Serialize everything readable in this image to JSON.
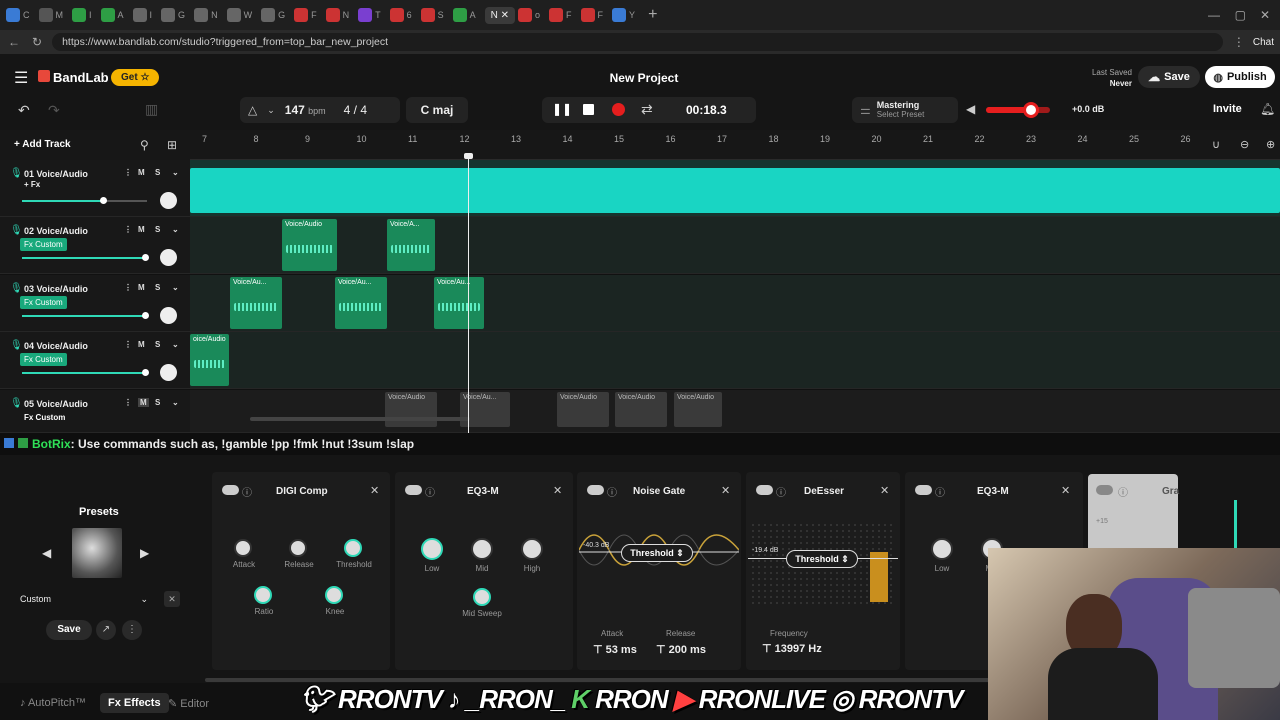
{
  "browser": {
    "url": "https://www.bandlab.com/studio?triggered_from=top_bar_new_project",
    "active_tab_label": "N",
    "chat_label": "Chat"
  },
  "app": {
    "logo": "BandLab",
    "get_label": "Get",
    "project_title": "New Project",
    "last_saved_label": "Last Saved",
    "last_saved_value": "Never",
    "save_label": "Save",
    "publish_label": "Publish",
    "invite_label": "Invite"
  },
  "toolbar": {
    "bpm": "147",
    "bpm_unit": "bpm",
    "time_sig": "4 / 4",
    "key": "C maj",
    "time": "00:18.3",
    "mastering_label": "Mastering",
    "mastering_preset": "Select Preset",
    "volume_db": "+0.0 dB",
    "volume_level": 0.7,
    "add_track_label": "Add Track"
  },
  "ruler": [
    "7",
    "8",
    "9",
    "10",
    "11",
    "12",
    "13",
    "14",
    "15",
    "16",
    "17",
    "18",
    "19",
    "20",
    "21",
    "22",
    "23",
    "24",
    "25",
    "26"
  ],
  "tracks": [
    {
      "name": "01 Voice/Audio",
      "fx": "+ Fx",
      "vol": 0.65
    },
    {
      "name": "02 Voice/Audio",
      "fx": "Fx Custom",
      "vol": 0.98
    },
    {
      "name": "03 Voice/Audio",
      "fx": "Fx Custom",
      "vol": 0.98
    },
    {
      "name": "04 Voice/Audio",
      "fx": "Fx Custom",
      "vol": 0.98
    },
    {
      "name": "05 Voice/Audio",
      "fx": "Fx Custom",
      "vol": 0.98
    }
  ],
  "clip_labels": {
    "voice_audio": "Voice/Audio",
    "voice_a": "Voice/A...",
    "voice_au": "Voice/Au...",
    "oice_audio": "oice/Audio"
  },
  "chat": {
    "user": "BotRix",
    "message": ": Use commands such as, !gamble !pp !fmk !nut !3sum !slap"
  },
  "effects": {
    "presets_label": "Presets",
    "preset_value": "Custom",
    "save_label": "Save",
    "digi_comp": {
      "title": "DIGI Comp",
      "attack": "Attack",
      "release": "Release",
      "threshold": "Threshold",
      "ratio": "Ratio",
      "knee": "Knee"
    },
    "eq3m": {
      "title": "EQ3-M",
      "low": "Low",
      "mid": "Mid",
      "high": "High",
      "mid_sweep": "Mid Sweep"
    },
    "noise_gate": {
      "title": "Noise Gate",
      "db": "-40.3 dB",
      "threshold": "Threshold",
      "attack_label": "Attack",
      "attack_value": "53 ms",
      "release_label": "Release",
      "release_value": "200 ms"
    },
    "deesser": {
      "title": "DeEsser",
      "db": "-19.4 dB",
      "threshold": "Threshold",
      "freq_label": "Frequency",
      "freq_value": "13997 Hz"
    },
    "eq3m_2": {
      "title": "EQ3-M",
      "low": "Low",
      "mid": "Mid"
    },
    "partial_title": "Gra",
    "partial_value": "+15"
  },
  "footer": {
    "autopitch": "AutoPitch™",
    "effects": "Effects",
    "editor": "Editor"
  },
  "social": [
    "RRONTV",
    "_RRON_",
    "RRON",
    "RRONLIVE",
    "RRONTV"
  ],
  "colors": {
    "accent": "#2fd9b7",
    "lane_clip": "#1a8a5a",
    "record": "#e51e1e",
    "get_button": "#f5b400",
    "fx_badge": "#19a97c"
  }
}
